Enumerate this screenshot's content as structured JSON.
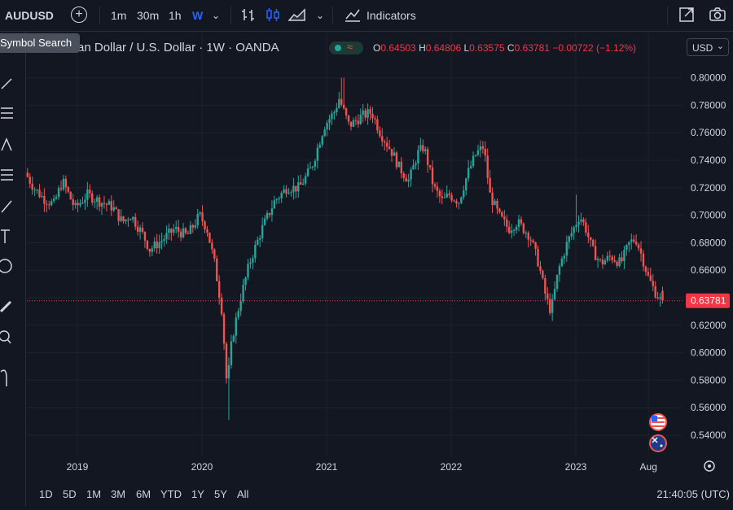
{
  "topbar": {
    "symbol": "AUDUSD",
    "add_icon": "plus-circle-icon",
    "intervals": [
      "1m",
      "30m",
      "1h",
      "W"
    ],
    "active_interval": "W",
    "indicators_label": "Indicators"
  },
  "tooltip": "Symbol Search",
  "legend": {
    "title": "Australian Dollar / U.S. Dollar · 1W · OANDA",
    "open_label": "O",
    "open": "0.64503",
    "high_label": "H",
    "high": "0.64806",
    "low_label": "L",
    "low": "0.63575",
    "close_label": "C",
    "close": "0.63781",
    "change": "−0.00722 (−1.12%)"
  },
  "currency": "USD",
  "bottombar": {
    "ranges": [
      "1D",
      "5D",
      "1M",
      "3M",
      "6M",
      "YTD",
      "1Y",
      "5Y",
      "All"
    ],
    "clock": "21:40:05 (UTC)"
  },
  "colors": {
    "up": "#26a69a",
    "down": "#ef5350",
    "bg": "#131722",
    "grid": "#1e222d",
    "price_line": "#f23645"
  },
  "chart_data": {
    "type": "candlestick",
    "symbol": "AUDUSD",
    "interval": "1W",
    "y_axis_labels": [
      "0.80000",
      "0.78000",
      "0.76000",
      "0.74000",
      "0.72000",
      "0.70000",
      "0.68000",
      "0.66000",
      "0.64000",
      "0.62000",
      "0.60000",
      "0.58000",
      "0.56000",
      "0.54000"
    ],
    "ylim": [
      0.53,
      0.81
    ],
    "x_axis_labels": [
      {
        "label": "2019",
        "t": 2019.0
      },
      {
        "label": "2020",
        "t": 2020.0
      },
      {
        "label": "2021",
        "t": 2021.0
      },
      {
        "label": "2022",
        "t": 2022.0
      },
      {
        "label": "2023",
        "t": 2023.0
      },
      {
        "label": "Aug",
        "t": 2023.583
      }
    ],
    "xlim": [
      2018.6,
      2023.8
    ],
    "last_price": 0.63781,
    "last_price_label": "0.63781",
    "series_points": [
      [
        2018.6,
        0.731
      ],
      [
        2018.67,
        0.72
      ],
      [
        2018.75,
        0.712
      ],
      [
        2018.83,
        0.708
      ],
      [
        2018.9,
        0.725
      ],
      [
        2019.0,
        0.705
      ],
      [
        2019.1,
        0.715
      ],
      [
        2019.2,
        0.71
      ],
      [
        2019.3,
        0.706
      ],
      [
        2019.38,
        0.695
      ],
      [
        2019.45,
        0.7
      ],
      [
        2019.55,
        0.685
      ],
      [
        2019.6,
        0.675
      ],
      [
        2019.7,
        0.682
      ],
      [
        2019.8,
        0.69
      ],
      [
        2019.9,
        0.685
      ],
      [
        2020.0,
        0.7
      ],
      [
        2020.06,
        0.69
      ],
      [
        2020.12,
        0.665
      ],
      [
        2020.18,
        0.63
      ],
      [
        2020.22,
        0.575
      ],
      [
        2020.26,
        0.61
      ],
      [
        2020.33,
        0.64
      ],
      [
        2020.4,
        0.665
      ],
      [
        2020.5,
        0.69
      ],
      [
        2020.6,
        0.71
      ],
      [
        2020.7,
        0.72
      ],
      [
        2020.8,
        0.72
      ],
      [
        2020.9,
        0.735
      ],
      [
        2021.0,
        0.765
      ],
      [
        2021.08,
        0.775
      ],
      [
        2021.12,
        0.785
      ],
      [
        2021.2,
        0.765
      ],
      [
        2021.3,
        0.772
      ],
      [
        2021.38,
        0.775
      ],
      [
        2021.45,
        0.76
      ],
      [
        2021.55,
        0.745
      ],
      [
        2021.6,
        0.735
      ],
      [
        2021.68,
        0.725
      ],
      [
        2021.75,
        0.745
      ],
      [
        2021.8,
        0.75
      ],
      [
        2021.88,
        0.72
      ],
      [
        2021.95,
        0.71
      ],
      [
        2022.0,
        0.715
      ],
      [
        2022.08,
        0.71
      ],
      [
        2022.15,
        0.73
      ],
      [
        2022.22,
        0.745
      ],
      [
        2022.28,
        0.75
      ],
      [
        2022.33,
        0.715
      ],
      [
        2022.4,
        0.7
      ],
      [
        2022.48,
        0.69
      ],
      [
        2022.55,
        0.695
      ],
      [
        2022.65,
        0.685
      ],
      [
        2022.72,
        0.665
      ],
      [
        2022.78,
        0.64
      ],
      [
        2022.82,
        0.63
      ],
      [
        2022.88,
        0.66
      ],
      [
        2022.95,
        0.68
      ],
      [
        2023.0,
        0.69
      ],
      [
        2023.05,
        0.7
      ],
      [
        2023.1,
        0.69
      ],
      [
        2023.15,
        0.675
      ],
      [
        2023.22,
        0.665
      ],
      [
        2023.3,
        0.67
      ],
      [
        2023.38,
        0.665
      ],
      [
        2023.45,
        0.68
      ],
      [
        2023.5,
        0.683
      ],
      [
        2023.55,
        0.67
      ],
      [
        2023.6,
        0.655
      ],
      [
        2023.65,
        0.645
      ],
      [
        2023.7,
        0.638
      ]
    ],
    "extremes": [
      [
        2020.22,
        0.551
      ],
      [
        2021.13,
        0.8
      ],
      [
        2023.0,
        0.715
      ]
    ]
  }
}
